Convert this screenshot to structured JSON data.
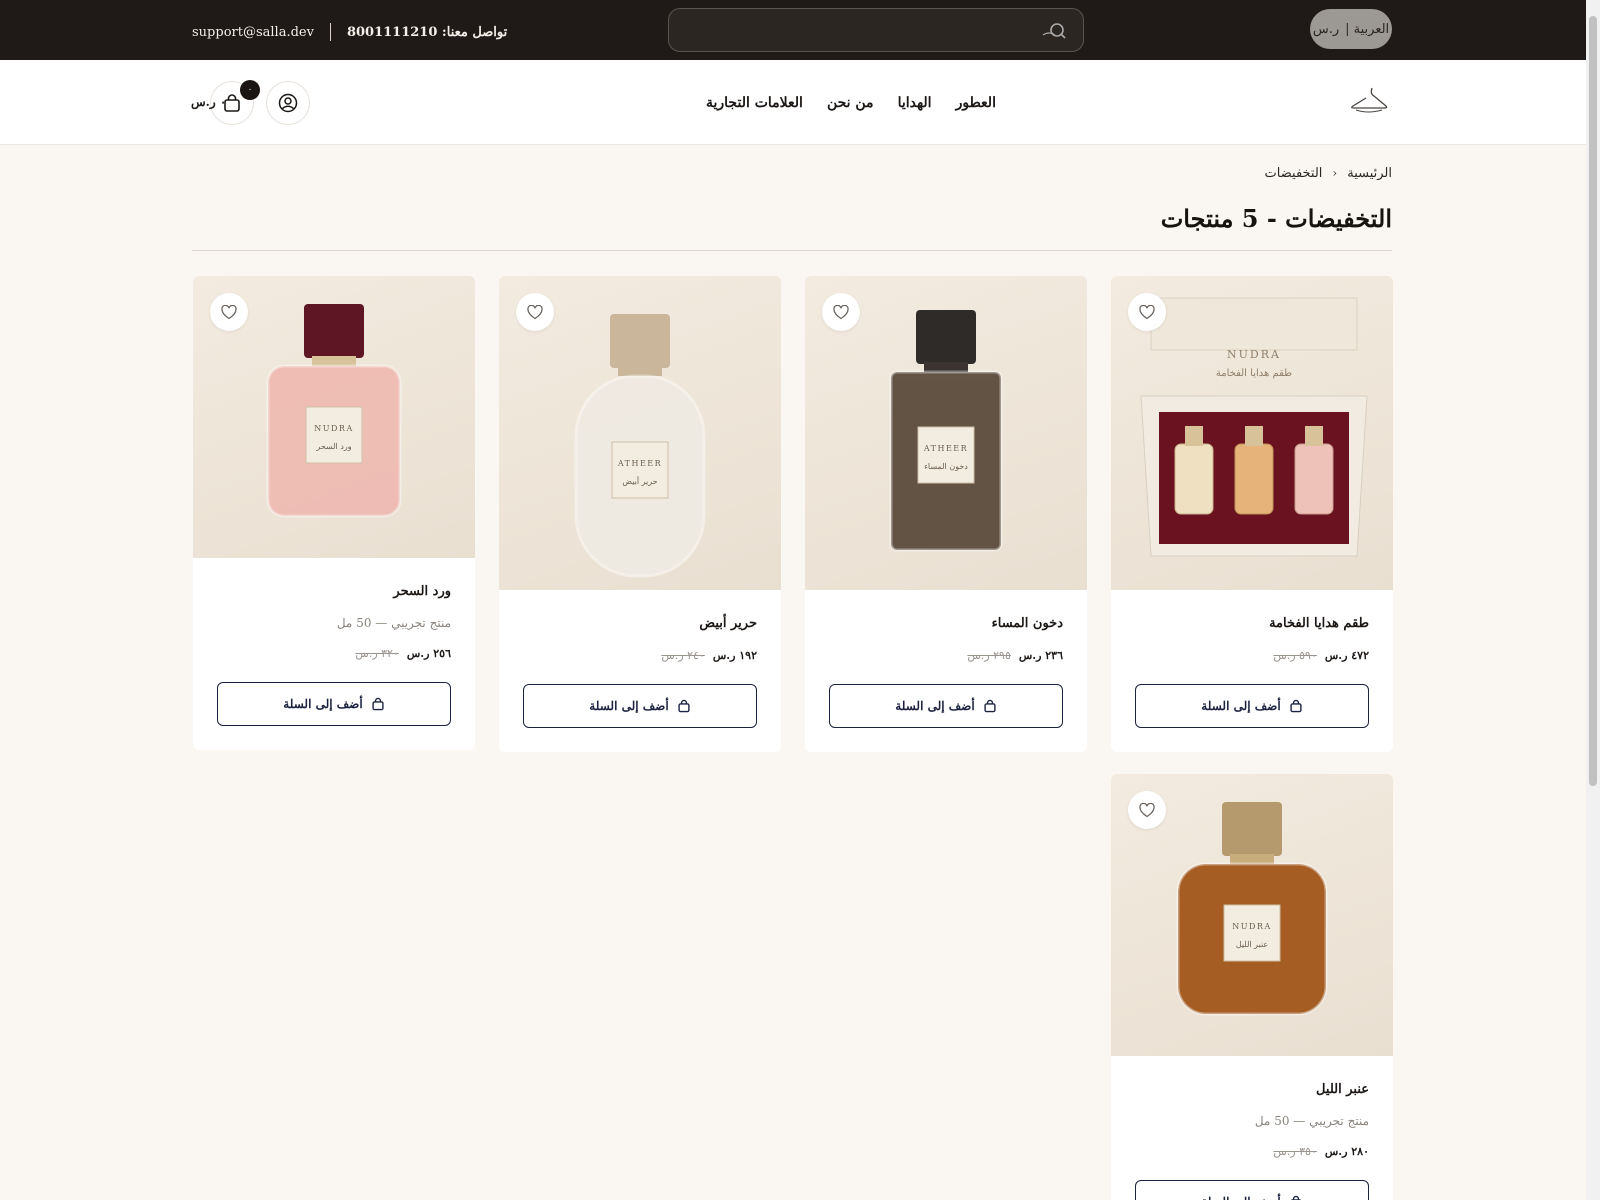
{
  "topbar": {
    "language_label": "العربية |",
    "currency_symbol": "ر.س",
    "search_placeholder": "",
    "phone_label": "تواصل معنا: 8001111210",
    "email": "support@salla.dev"
  },
  "header": {
    "nav": [
      "العطور",
      "الهدايا",
      "من نحن",
      "العلامات التجارية"
    ],
    "cart_count": "٠",
    "cart_total": "٠ ر.س"
  },
  "breadcrumb": {
    "home": "الرئيسية",
    "current": "التخفيضات"
  },
  "page_title": "التخفيضات - 5 منتجات",
  "products": [
    {
      "name": "طقم هدايا الفخامة",
      "subtitle": "",
      "price": "٤٧٢ ر.س",
      "old_price": "٥٩٠ ر.س",
      "add_label": "أضف إلى السلة",
      "bottle": "giftset",
      "box_text": "NUDRA",
      "box_sub": "طقم هدايا الفخامة"
    },
    {
      "name": "دخون المساء",
      "subtitle": "",
      "price": "٢٣٦ ر.س",
      "old_price": "٢٩٥ ر.س",
      "add_label": "أضف إلى السلة",
      "bottle": "dark",
      "label_text": "ATHEER",
      "label_sub": "دخون المساء"
    },
    {
      "name": "حرير أبيض",
      "subtitle": "",
      "price": "١٩٢ ر.س",
      "old_price": "٢٤٠ ر.س",
      "add_label": "أضف إلى السلة",
      "bottle": "white",
      "label_text": "ATHEER",
      "label_sub": "حرير أبيض"
    },
    {
      "name": "ورد السحر",
      "subtitle": "منتج تجريبي — 50 مل",
      "price": "٢٥٦ ر.س",
      "old_price": "٣٢٠ ر.س",
      "add_label": "أضف إلى السلة",
      "bottle": "pink",
      "label_text": "NUDRA",
      "label_sub": "ورد السحر"
    },
    {
      "name": "عنبر الليل",
      "subtitle": "منتج تجريبي — 50 مل",
      "price": "٢٨٠ ر.س",
      "old_price": "٣٥٠ ر.س",
      "add_label": "أضف إلى السلة",
      "bottle": "amber",
      "label_text": "NUDRA",
      "label_sub": "عنبر الليل"
    }
  ],
  "colors": {
    "topbar": "#1f1a17",
    "accent_navy": "#1c2340",
    "page_bg": "#faf7f3"
  }
}
